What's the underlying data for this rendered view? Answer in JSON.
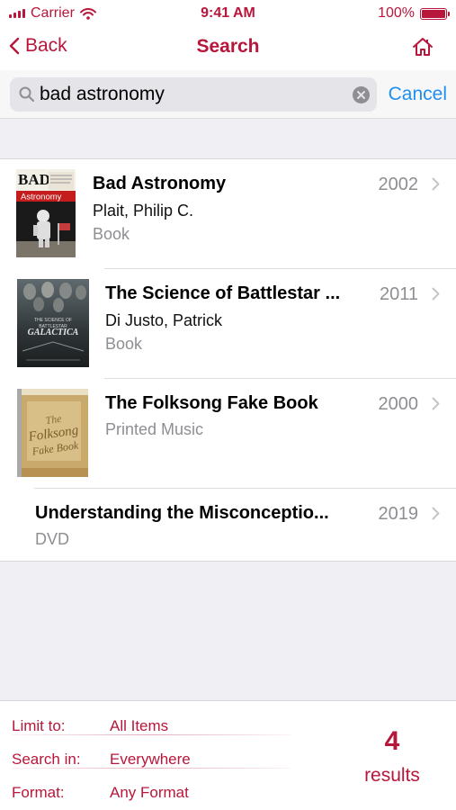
{
  "status": {
    "carrier": "Carrier",
    "time": "9:41 AM",
    "battery": "100%",
    "battery_level": 1.0
  },
  "nav": {
    "back_label": "Back",
    "title": "Search",
    "home_icon": "house-icon"
  },
  "search": {
    "query": "bad astronomy",
    "cancel_label": "Cancel",
    "search_icon": "magnifier-icon",
    "clear_icon": "clear-x-icon"
  },
  "results": [
    {
      "title": "Bad Astronomy",
      "author": "Plait, Philip C.",
      "format": "Book",
      "year": "2002",
      "cover": "bad-astronomy-cover"
    },
    {
      "title": "The Science of Battlestar ...",
      "author": "Di Justo, Patrick",
      "format": "Book",
      "year": "2011",
      "cover": "battlestar-galactica-cover"
    },
    {
      "title": "The Folksong Fake Book",
      "author": "",
      "format": "Printed Music",
      "year": "2000",
      "cover": "folksong-fake-book-cover"
    },
    {
      "title": "Understanding the Misconceptio...",
      "author": "",
      "format": "DVD",
      "year": "2019",
      "cover": ""
    }
  ],
  "footer": {
    "limit_label": "Limit to:",
    "limit_value": "All Items",
    "search_in_label": "Search in:",
    "search_in_value": "Everywhere",
    "format_label": "Format:",
    "format_value": "Any Format",
    "count": "4",
    "count_label": "results"
  },
  "colors": {
    "accent": "#b8163a",
    "link_blue": "#1e8ff0",
    "secondary_text": "#8e8e93",
    "background": "#efeff4"
  }
}
